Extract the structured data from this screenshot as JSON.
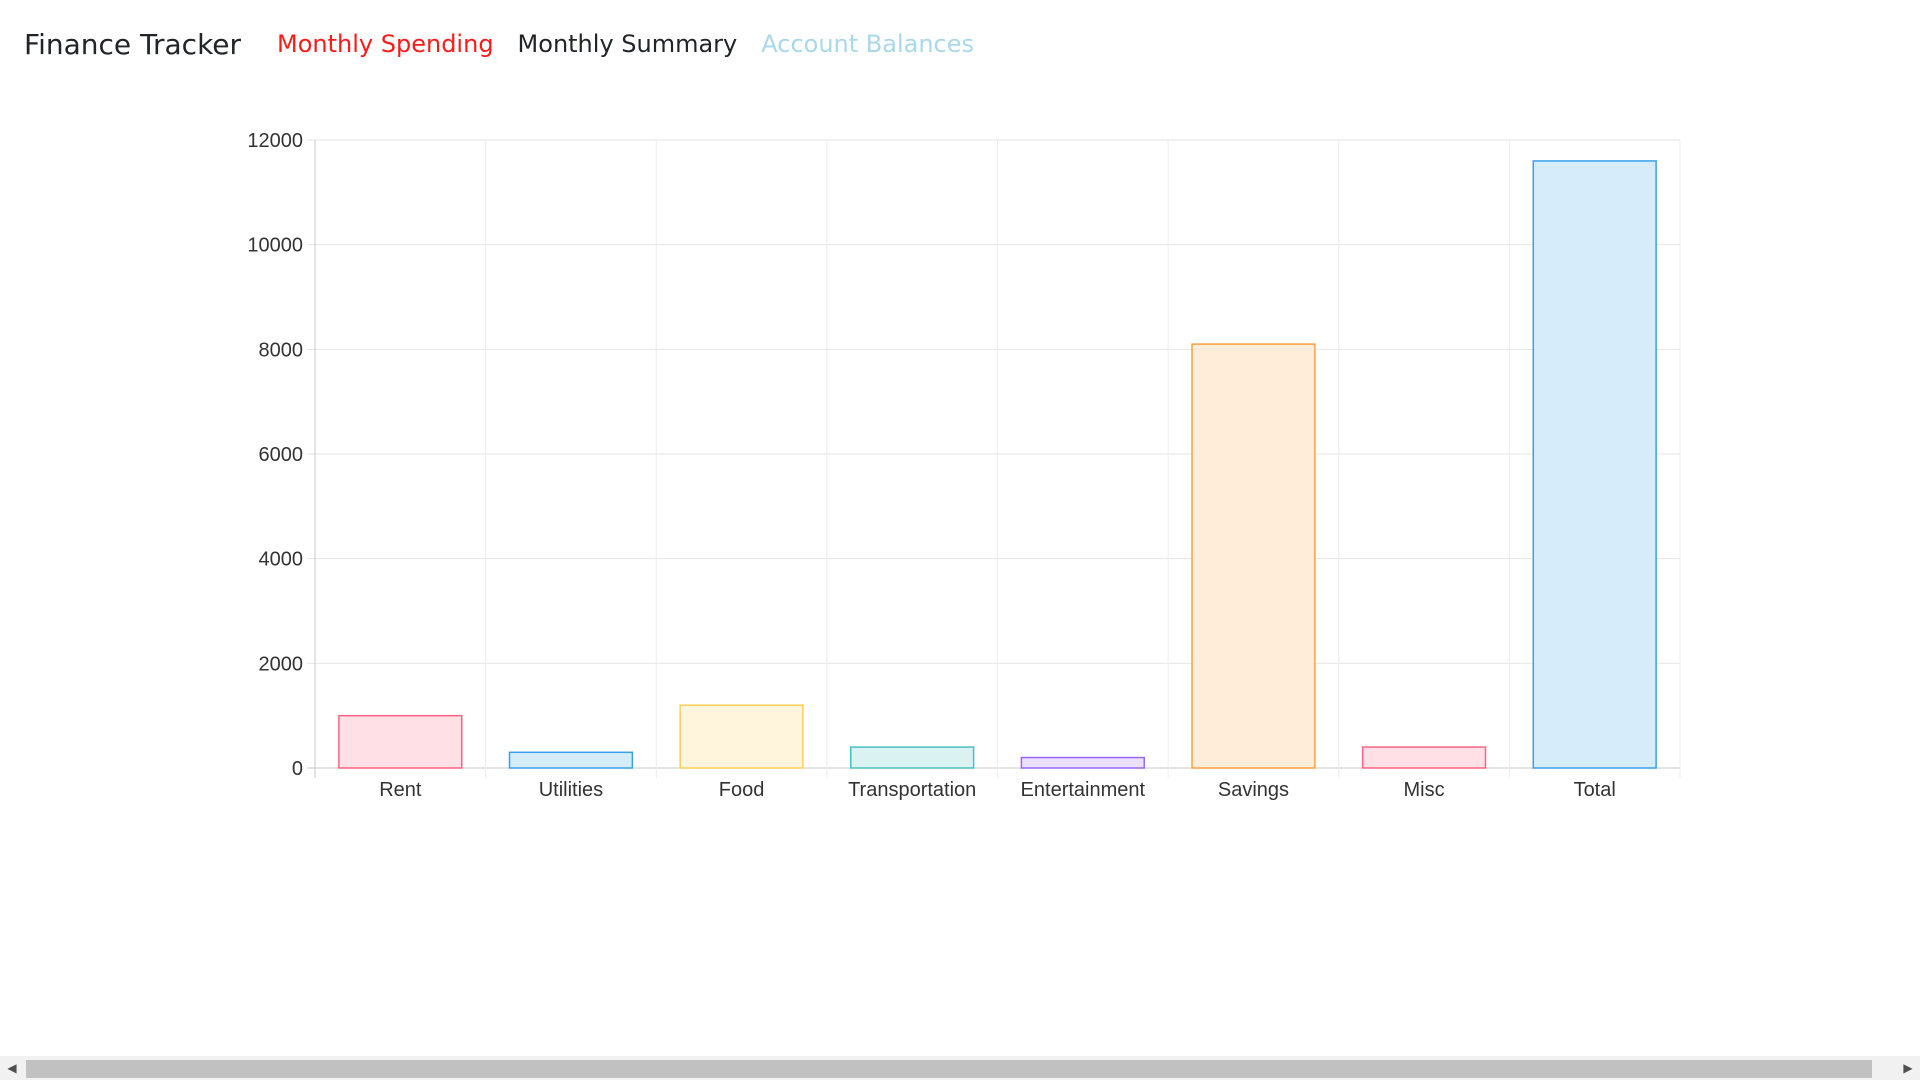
{
  "nav": {
    "brand": "Finance Tracker",
    "links": [
      {
        "label": "Monthly Spending",
        "color": "#ff1a1a"
      },
      {
        "label": "Monthly Summary",
        "color": "#212529"
      },
      {
        "label": "Account Balances",
        "color": "#a8d8ea"
      }
    ]
  },
  "chart_data": {
    "type": "bar",
    "categories": [
      "Rent",
      "Utilities",
      "Food",
      "Transportation",
      "Entertainment",
      "Savings",
      "Misc",
      "Total"
    ],
    "values": [
      1000,
      300,
      1200,
      400,
      200,
      8100,
      400,
      11600
    ],
    "ylim": [
      0,
      12000
    ],
    "yticks": [
      "0",
      "2000",
      "4000",
      "6000",
      "8000",
      "10000",
      "12000"
    ],
    "grid": true,
    "bar_fill_colors": [
      "#ffe0e6",
      "#d7ecfb",
      "#fff5dd",
      "#dbf2f2",
      "#ebe0ff",
      "#ffecd9",
      "#ffe0e6",
      "#d7ecfb"
    ],
    "bar_border_colors": [
      "#ff6384",
      "#36a2eb",
      "#ffce56",
      "#4bc0c0",
      "#9966ff",
      "#ff9f40",
      "#ff6384",
      "#36a2eb"
    ]
  },
  "scrollbar": {
    "left_icon": "scroll-left-arrow-icon",
    "right_icon": "scroll-right-arrow-icon"
  }
}
